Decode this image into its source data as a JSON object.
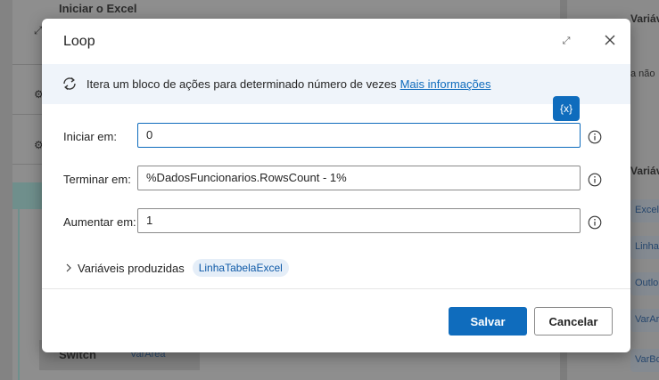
{
  "background": {
    "flow_title": "Iniciar o Excel",
    "switch_label": "Switch",
    "switch_var": "VarArea",
    "panel_head_1": "Variáv",
    "panel_text_1": "a não",
    "panel_head_2": "Variáve",
    "panel_chips": [
      "Excel",
      "Linha",
      "Outlo",
      "VarAr",
      "VarBo"
    ]
  },
  "dialog": {
    "title": "Loop",
    "info_text": "Itera um bloco de ações para determinado número de vezes",
    "info_link": "Mais informações",
    "var_button": "{x}",
    "fields": [
      {
        "label": "Iniciar em:",
        "value": "0"
      },
      {
        "label": "Terminar em:",
        "value": "%DadosFuncionarios.RowsCount - 1%"
      },
      {
        "label": "Aumentar em:",
        "value": "1"
      }
    ],
    "produced_label": "Variáveis produzidas",
    "produced_var": "LinhaTabelaExcel",
    "save_label": "Salvar",
    "cancel_label": "Cancelar"
  },
  "colors": {
    "accent": "#0f6cbd",
    "info_band": "#eff4fa",
    "chip_bg": "#e5eef8"
  }
}
